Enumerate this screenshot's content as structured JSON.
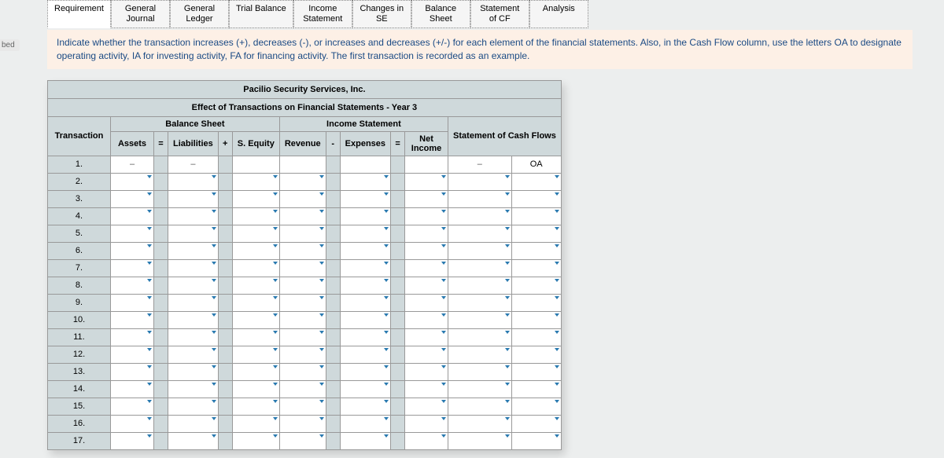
{
  "sidebar_label": "bed",
  "tabs": [
    "Requirement",
    "General\nJournal",
    "General\nLedger",
    "Trial Balance",
    "Income\nStatement",
    "Changes in\nSE",
    "Balance\nSheet",
    "Statement\nof CF",
    "Analysis"
  ],
  "instruction": "Indicate whether the transaction increases (+), decreases (-), or increases and decreases (+/-) for each element of the financial statements. Also, in the Cash Flow column, use the letters OA to designate operating activity, IA for investing activity, FA for financing activity. The first transaction is recorded as an example.",
  "table": {
    "company": "Pacilio Security Services, Inc.",
    "subtitle": "Effect of Transactions on Financial Statements - Year 3",
    "groups": {
      "balance_sheet": "Balance Sheet",
      "income_statement": "Income Statement",
      "cash_flows": "Statement of Cash Flows"
    },
    "columns": {
      "transaction": "Transaction",
      "assets": "Assets",
      "op_eq": "=",
      "liabilities": "Liabilities",
      "op_plus": "+",
      "sequity": "S. Equity",
      "revenue": "Revenue",
      "op_minus": "-",
      "expenses": "Expenses",
      "op_eq2": "=",
      "net_income": "Net\nIncome",
      "cf_amount": "",
      "cf_type": ""
    },
    "example_row": {
      "label": "1.",
      "assets": "–",
      "liabilities": "–",
      "cf_amount": "–",
      "cf_type": "OA"
    },
    "rows": [
      "2.",
      "3.",
      "4.",
      "5.",
      "6.",
      "7.",
      "8.",
      "9.",
      "10.",
      "11.",
      "12.",
      "13.",
      "14.",
      "15.",
      "16.",
      "17."
    ]
  }
}
